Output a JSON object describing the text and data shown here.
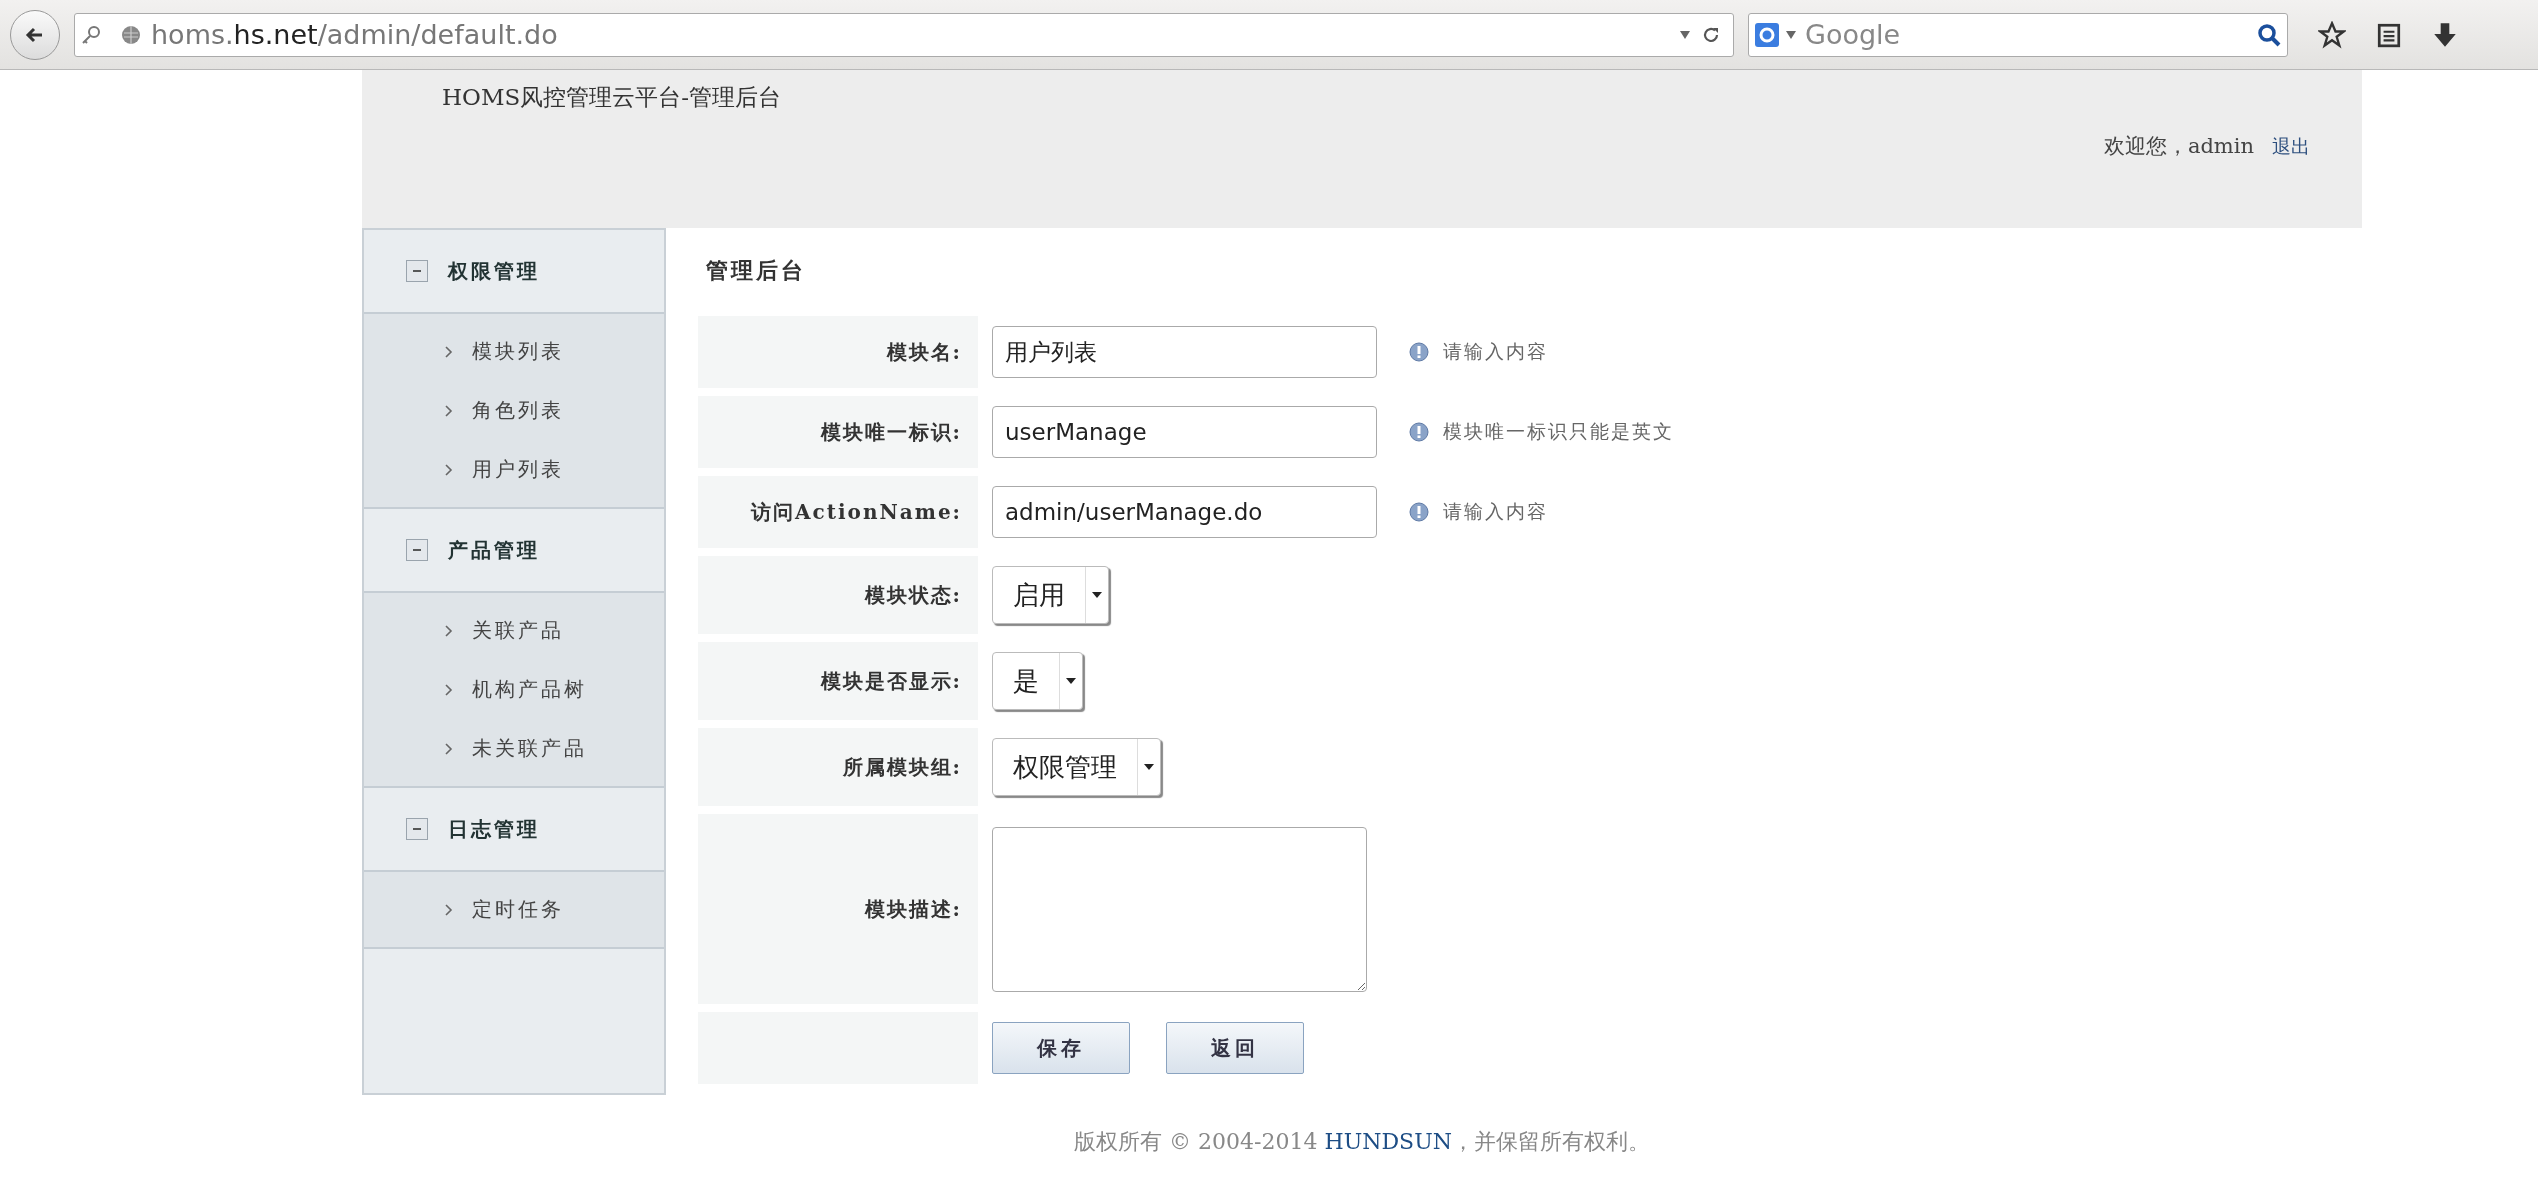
{
  "browser": {
    "url_host": "homs.",
    "url_domain": "hs.net",
    "url_path": "/admin/default.do",
    "search_placeholder": "Google"
  },
  "header": {
    "title": "HOMS风控管理云平台-管理后台",
    "welcome": "欢迎您，admin",
    "logout": "退出"
  },
  "sidebar": {
    "groups": [
      {
        "label": "权限管理",
        "expanded": true,
        "items": [
          "模块列表",
          "角色列表",
          "用户列表"
        ]
      },
      {
        "label": "产品管理",
        "expanded": true,
        "items": [
          "关联产品",
          "机构产品树",
          "未关联产品"
        ]
      },
      {
        "label": "日志管理",
        "expanded": true,
        "items": [
          "定时任务"
        ]
      }
    ]
  },
  "page_title": "管理后台",
  "form": {
    "rows": [
      {
        "kind": "text",
        "label": "模块名:",
        "value": "用户列表",
        "hint": "请输入内容"
      },
      {
        "kind": "text",
        "label": "模块唯一标识:",
        "value": "userManage",
        "hint": "模块唯一标识只能是英文"
      },
      {
        "kind": "text",
        "label": "访问ActionName:",
        "value": "admin/userManage.do",
        "hint": "请输入内容"
      },
      {
        "kind": "select",
        "label": "模块状态:",
        "value": "启用"
      },
      {
        "kind": "select",
        "label": "模块是否显示:",
        "value": "是"
      },
      {
        "kind": "select",
        "label": "所属模块组:",
        "value": "权限管理"
      },
      {
        "kind": "textarea",
        "label": "模块描述:"
      }
    ],
    "buttons": [
      "保存",
      "返回"
    ]
  },
  "footer": {
    "before": "版权所有 © 2004-2014 ",
    "link": "HUNDSUN",
    "after": "，并保留所有权利。"
  }
}
